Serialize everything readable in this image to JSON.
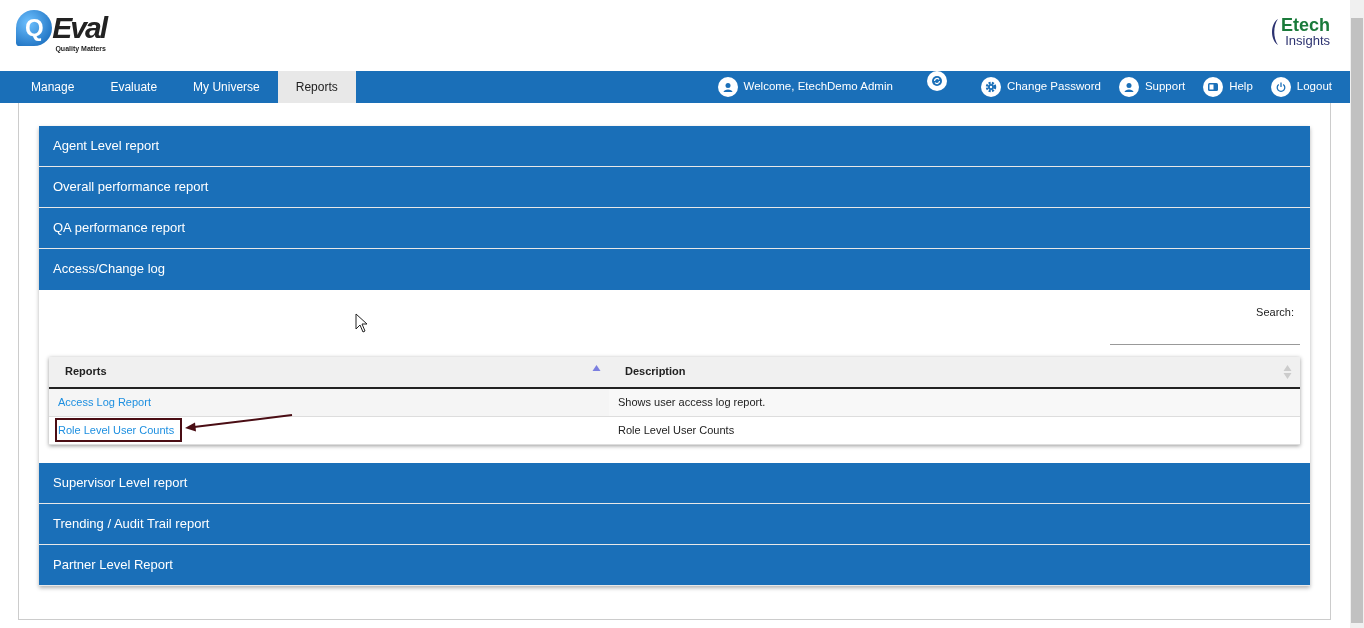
{
  "brand": {
    "mark": "Q",
    "name": "Eval",
    "tagline": "Quality Matters"
  },
  "partner_logo": {
    "name": "Etech",
    "tagline": "Insights"
  },
  "nav": [
    {
      "label": "Manage",
      "selected": false
    },
    {
      "label": "Evaluate",
      "selected": false
    },
    {
      "label": "My Universe",
      "selected": false
    },
    {
      "label": "Reports",
      "selected": true
    }
  ],
  "user_menu": [
    {
      "kind": "user",
      "label": "Welcome, EtechDemo Admin"
    },
    {
      "kind": "sync"
    },
    {
      "kind": "gear",
      "label": "Change Password"
    },
    {
      "kind": "user",
      "label": "Support"
    },
    {
      "kind": "panel",
      "label": "Help"
    },
    {
      "kind": "power",
      "label": "Logout"
    }
  ],
  "sections": [
    {
      "title": "Agent Level report",
      "expanded": false
    },
    {
      "title": "Overall performance report",
      "expanded": false
    },
    {
      "title": "QA performance report",
      "expanded": false
    },
    {
      "title": "Access/Change log",
      "expanded": true,
      "search": {
        "label": "Search:"
      },
      "table": {
        "columns": [
          {
            "label": "Reports",
            "sorted": true
          },
          {
            "label": "Description",
            "sorted": false
          }
        ],
        "rows": [
          {
            "report": "Access Log Report",
            "description": "Shows user access log report.",
            "highlighted": false
          },
          {
            "report": "Role Level User Counts",
            "description": "Role Level User Counts",
            "highlighted": true
          }
        ]
      }
    },
    {
      "title": "Supervisor Level report",
      "expanded": false
    },
    {
      "title": "Trending / Audit Trail report",
      "expanded": false
    },
    {
      "title": "Partner Level Report",
      "expanded": false
    }
  ]
}
